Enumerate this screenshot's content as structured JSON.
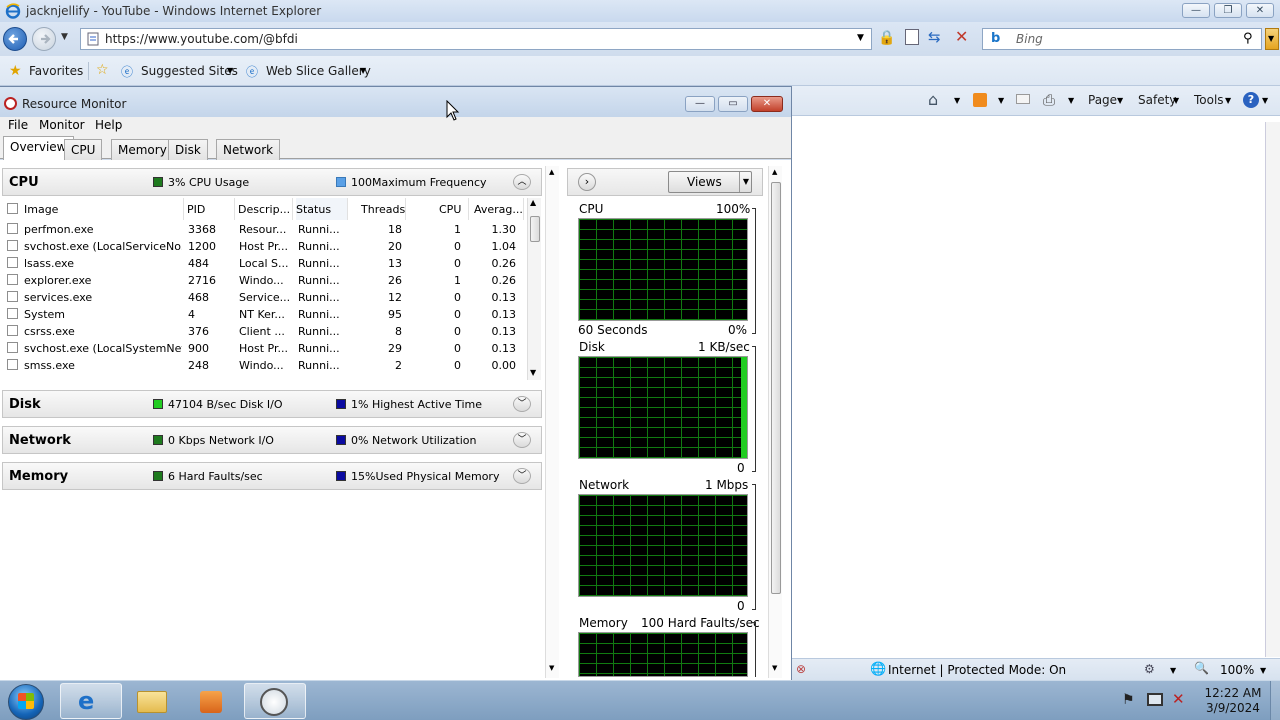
{
  "ie": {
    "window_title": "jacknjellify - YouTube - Windows Internet Explorer",
    "url": "https://www.youtube.com/@bfdi",
    "search_placeholder": "Bing",
    "favorites": {
      "favorites_label": "Favorites",
      "suggested_sites_label": "Suggested Sites",
      "web_slice_gallery_label": "Web Slice Gallery"
    },
    "commands": {
      "page_label": "Page",
      "safety_label": "Safety",
      "tools_label": "Tools"
    },
    "status": {
      "zone_text": "Internet | Protected Mode: On",
      "zoom": "100%"
    }
  },
  "resmon": {
    "title": "Resource Monitor",
    "menu": [
      "File",
      "Monitor",
      "Help"
    ],
    "tabs": [
      "Overview",
      "CPU",
      "Memory",
      "Disk",
      "Network"
    ],
    "active_tab": "Overview",
    "cpu_section": {
      "name": "CPU",
      "indicator1": "3% CPU Usage",
      "indicator1_color": "#1e7a1e",
      "indicator2": "100Maximum Frequency",
      "indicator2_color": "#5aa0e6",
      "columns": [
        "Image",
        "PID",
        "Descrip...",
        "Status",
        "Threads",
        "CPU",
        "Averag..."
      ],
      "rows": [
        [
          "perfmon.exe",
          "3368",
          "Resour...",
          "Runni...",
          "18",
          "1",
          "1.30"
        ],
        [
          "svchost.exe (LocalServiceNo...",
          "1200",
          "Host Pr...",
          "Runni...",
          "20",
          "0",
          "1.04"
        ],
        [
          "lsass.exe",
          "484",
          "Local S...",
          "Runni...",
          "13",
          "0",
          "0.26"
        ],
        [
          "explorer.exe",
          "2716",
          "Windo...",
          "Runni...",
          "26",
          "1",
          "0.26"
        ],
        [
          "services.exe",
          "468",
          "Service...",
          "Runni...",
          "12",
          "0",
          "0.13"
        ],
        [
          "System",
          "4",
          "NT Ker...",
          "Runni...",
          "95",
          "0",
          "0.13"
        ],
        [
          "csrss.exe",
          "376",
          "Client ...",
          "Runni...",
          "8",
          "0",
          "0.13"
        ],
        [
          "svchost.exe (LocalSystemNet...",
          "900",
          "Host Pr...",
          "Runni...",
          "29",
          "0",
          "0.13"
        ],
        [
          "smss.exe",
          "248",
          "Windo...",
          "Runni...",
          "2",
          "0",
          "0.00"
        ]
      ]
    },
    "disk_section": {
      "name": "Disk",
      "indicator1": "47104 B/sec Disk I/O",
      "indicator1_color": "#22cc22",
      "indicator2": "1% Highest Active Time",
      "indicator2_color": "#0a0aa0"
    },
    "network_section": {
      "name": "Network",
      "indicator1": "0 Kbps Network I/O",
      "indicator1_color": "#1e7a1e",
      "indicator2": "0% Network Utilization",
      "indicator2_color": "#0a0aa0"
    },
    "memory_section": {
      "name": "Memory",
      "indicator1": "6 Hard Faults/sec",
      "indicator1_color": "#1e7a1e",
      "indicator2": "15%Used Physical Memory",
      "indicator2_color": "#0a0aa0"
    },
    "graphs": {
      "views_label": "Views",
      "cpu_title": "CPU",
      "cpu_max": "100%",
      "cpu_time": "60 Seconds",
      "cpu_min": "0%",
      "disk_title": "Disk",
      "disk_max": "1 KB/sec",
      "disk_min": "0",
      "network_title": "Network",
      "network_max": "1 Mbps",
      "network_min": "0",
      "memory_title": "Memory",
      "memory_max": "100 Hard Faults/sec"
    }
  },
  "taskbar": {
    "time": "12:22 AM",
    "date": "3/9/2024"
  }
}
